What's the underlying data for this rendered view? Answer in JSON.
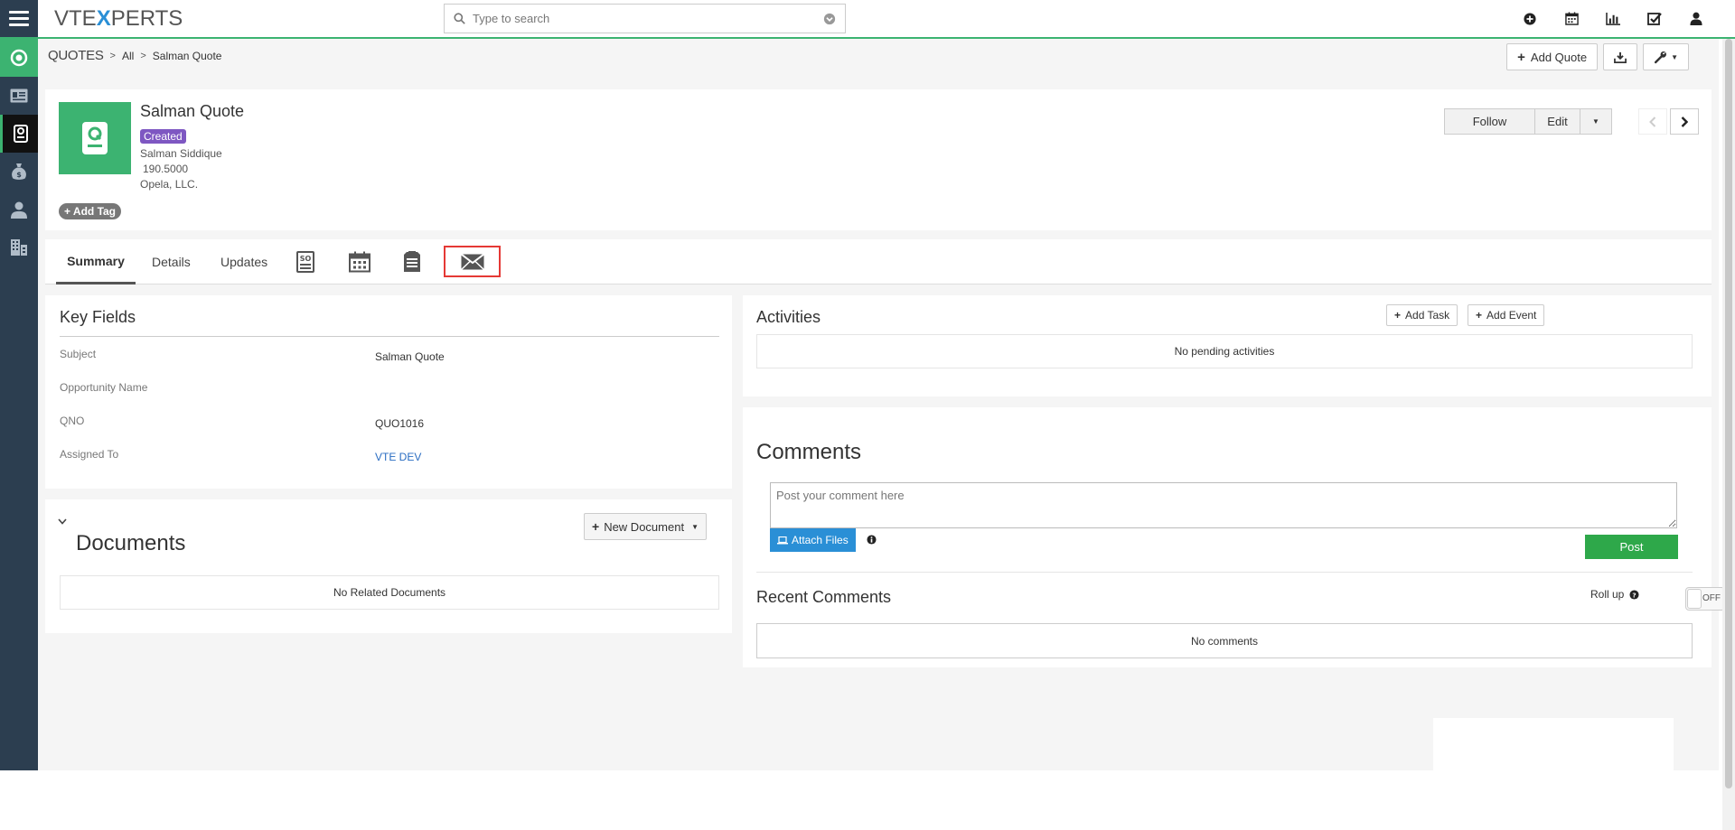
{
  "app": {
    "logo_pre": "VTE",
    "logo_x": "X",
    "logo_post": "PERTS",
    "search_placeholder": "Type to search"
  },
  "breadcrumb": {
    "module": "QUOTES",
    "all": "All",
    "current": "Salman Quote"
  },
  "toolbar": {
    "add_label": "Add Quote"
  },
  "record": {
    "title": "Salman Quote",
    "status": "Created",
    "contact": "Salman Siddique",
    "amount": "190.5000",
    "organization": "Opela, LLC.",
    "add_tag": "Add Tag",
    "follow": "Follow",
    "edit": "Edit"
  },
  "tabs": {
    "summary": "Summary",
    "details": "Details",
    "updates": "Updates"
  },
  "key_fields": {
    "title": "Key Fields",
    "rows": [
      {
        "label": "Subject",
        "value": "Salman Quote"
      },
      {
        "label": "Opportunity Name",
        "value": ""
      },
      {
        "label": "QNO",
        "value": "QUO1016"
      },
      {
        "label": "Assigned To",
        "value": "VTE DEV"
      }
    ]
  },
  "documents": {
    "title": "Documents",
    "new_button": "New Document",
    "empty": "No Related Documents"
  },
  "activities": {
    "title": "Activities",
    "add_task": "Add Task",
    "add_event": "Add Event",
    "empty": "No pending activities"
  },
  "comments": {
    "title": "Comments",
    "placeholder": "Post your comment here",
    "attach": "Attach Files",
    "post": "Post",
    "recent_title": "Recent Comments",
    "rollup": "Roll up",
    "toggle": "OFF",
    "empty": "No comments"
  },
  "colors": {
    "accent": "#3cb371",
    "sidebar": "#2c3e50",
    "badge": "#7e57c2",
    "attach": "#2a8fd6",
    "post": "#2ea84a",
    "highlight": "#e53935"
  }
}
